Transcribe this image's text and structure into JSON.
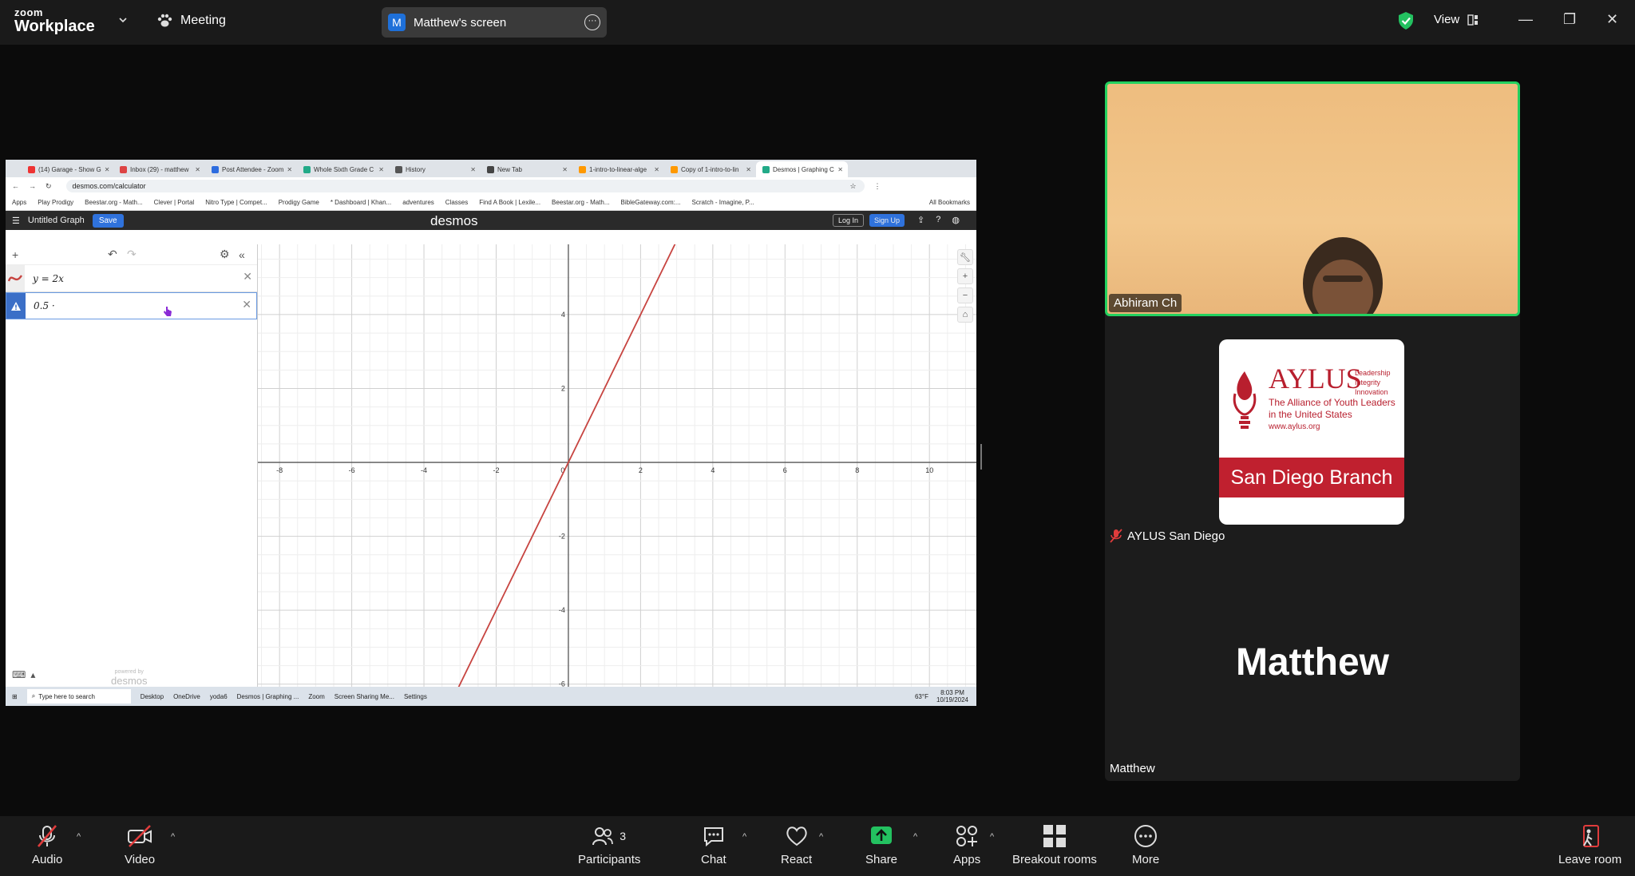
{
  "zoom": {
    "logo_top": "zoom",
    "logo_bottom": "Workplace",
    "meeting_label": "Meeting",
    "share_initial": "M",
    "share_label": "Matthew's screen",
    "view_label": "View"
  },
  "browser": {
    "tabs": [
      {
        "label": "(14) Garage - Show G",
        "color": "#e33"
      },
      {
        "label": "Inbox (29) - matthew",
        "color": "#d44"
      },
      {
        "label": "Post Attendee - Zoom",
        "color": "#2d6cdf"
      },
      {
        "label": "Whole Sixth Grade C",
        "color": "#2a8"
      },
      {
        "label": "History",
        "color": "#555"
      },
      {
        "label": "New Tab",
        "color": "#444"
      },
      {
        "label": "1-intro-to-linear-alge",
        "color": "#f90"
      },
      {
        "label": "Copy of 1-intro-to-lin",
        "color": "#f90"
      },
      {
        "label": "Desmos | Graphing C",
        "color": "#2a8"
      }
    ],
    "url": "desmos.com/calculator",
    "bookmarks": [
      "Apps",
      "Play Prodigy",
      "Beestar.org - Math...",
      "Clever | Portal",
      "Nitro Type | Compet...",
      "Prodigy Game",
      "* Dashboard | Khan...",
      "adventures",
      "Classes",
      "Find A Book | Lexile...",
      "Beestar.org - Math...",
      "BibleGateway.com:...",
      "Scratch - Imagine, P..."
    ],
    "all_bookmarks": "All Bookmarks"
  },
  "desmos": {
    "graph_title": "Untitled Graph",
    "save": "Save",
    "brand": "desmos",
    "login": "Log In",
    "signup": "Sign Up",
    "expressions": [
      "y = 2x",
      "0.5 ·"
    ],
    "powered_by": "powered by",
    "powered_brand": "desmos",
    "x_ticks": [
      "-8",
      "-6",
      "-4",
      "-2",
      "0",
      "2",
      "4",
      "6",
      "8",
      "10"
    ],
    "y_ticks": [
      "4",
      "2",
      "-2",
      "-4",
      "-6"
    ]
  },
  "taskbar": {
    "search": "Type here to search",
    "items": [
      "Desktop",
      "OneDrive",
      "yoda6",
      "Desmos | Graphing ...",
      "Zoom",
      "Screen Sharing Me...",
      "Settings"
    ],
    "weather": "63°F",
    "time": "8:03 PM",
    "date": "10/19/2024"
  },
  "participants": {
    "p1_name": "Abhiram Ch",
    "p2_name": "AYLUS San Diego",
    "p3_name": "Matthew",
    "p3_big": "Matthew"
  },
  "aylus_logo": {
    "title": "AYLUS",
    "tagline": [
      "Leadership",
      "Integrity",
      "Innovation"
    ],
    "sub1": "The Alliance of Youth Leaders",
    "sub2": "in the United States",
    "url": "www.aylus.org",
    "branch": "San Diego Branch"
  },
  "toolbar": {
    "audio": "Audio",
    "video": "Video",
    "participants": "Participants",
    "participants_count": "3",
    "chat": "Chat",
    "react": "React",
    "share": "Share",
    "apps": "Apps",
    "breakout": "Breakout rooms",
    "more": "More",
    "leave": "Leave room"
  },
  "chart_data": {
    "type": "line",
    "series": [
      {
        "name": "y = 2x",
        "x": [
          -3.2,
          3
        ],
        "values": [
          -6.4,
          6
        ]
      }
    ],
    "xlim": [
      -8.6,
      11.3
    ],
    "ylim": [
      -6.2,
      5.9
    ],
    "grid": true
  }
}
